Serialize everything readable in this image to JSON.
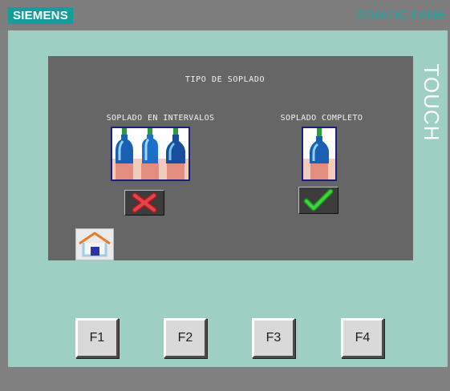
{
  "header": {
    "brand": "SIEMENS",
    "model": "SIMATIC PANE",
    "touch_label": "TOUCH"
  },
  "screen": {
    "title": "TIPO DE SOPLADO",
    "options": [
      {
        "label": "SOPLADO EN INTERVALOS",
        "state_icon": "cross-icon",
        "active": false
      },
      {
        "label": "SOPLADO COMPLETO",
        "state_icon": "check-icon",
        "active": true
      }
    ],
    "home_icon": "home-icon"
  },
  "function_keys": [
    "F1",
    "F2",
    "F3",
    "F4"
  ],
  "colors": {
    "brand": "#139d9b",
    "bezel": "#9dd0c2",
    "screen": "#666666",
    "cross": "#e0303a",
    "check": "#2fb52f"
  }
}
